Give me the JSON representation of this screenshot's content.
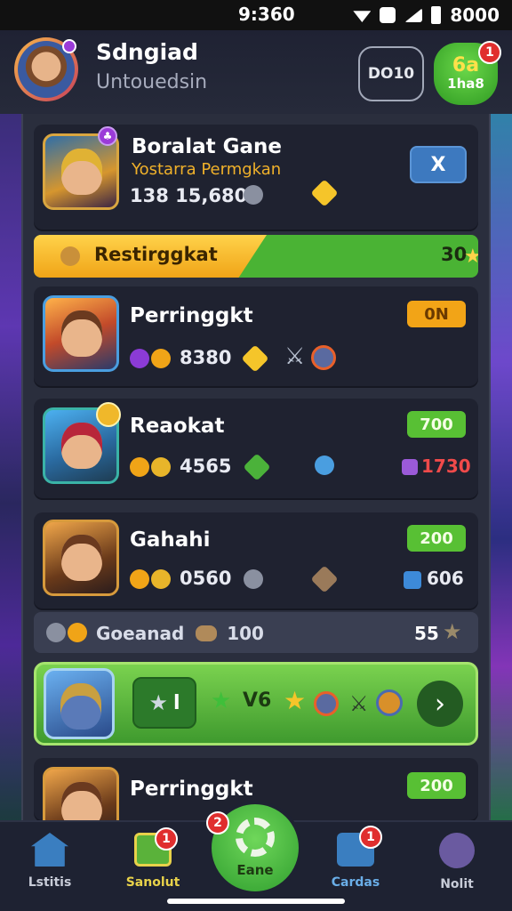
{
  "status_bar": {
    "time": "9:360",
    "battery": "8000"
  },
  "header": {
    "name": "Sdngiad",
    "subtitle": "Untouedsin",
    "button_label": "DO10",
    "green_button_top": "6a",
    "green_button_bottom": "1ha8",
    "green_badge": "1"
  },
  "featured": {
    "title": "Boralat Gane",
    "subtitle": "Yostarra Permgkan",
    "stats": "138 15,680",
    "close": "X"
  },
  "rank_bar": {
    "label": "Restirggkat",
    "count": "30"
  },
  "cards": [
    {
      "title": "Perringgkt",
      "stat": "8380",
      "pill": "0N"
    },
    {
      "title": "Reaokat",
      "stat": "4565",
      "pill": "700",
      "right_stat": "1730"
    },
    {
      "title": "Gahahi",
      "stat": "0560",
      "pill": "200",
      "right_stat": "606"
    },
    {
      "title": "Perringgkt",
      "pill": "200"
    }
  ],
  "summary": {
    "text": "Goeanad",
    "count_left": "100",
    "count_right": "55"
  },
  "promo": {
    "button": "l",
    "percent": "V6",
    "arrow": "›"
  },
  "nav": {
    "items": [
      {
        "label": "Lstitis"
      },
      {
        "label": "Sanolut",
        "badge": "1"
      },
      {
        "label": "Eane",
        "badge": "2"
      },
      {
        "label": "Cardas",
        "badge": "1"
      },
      {
        "label": "Nolit"
      }
    ]
  },
  "colors": {
    "accent_green": "#58c034",
    "accent_orange": "#f2a417",
    "blue": "#3d79bf"
  }
}
